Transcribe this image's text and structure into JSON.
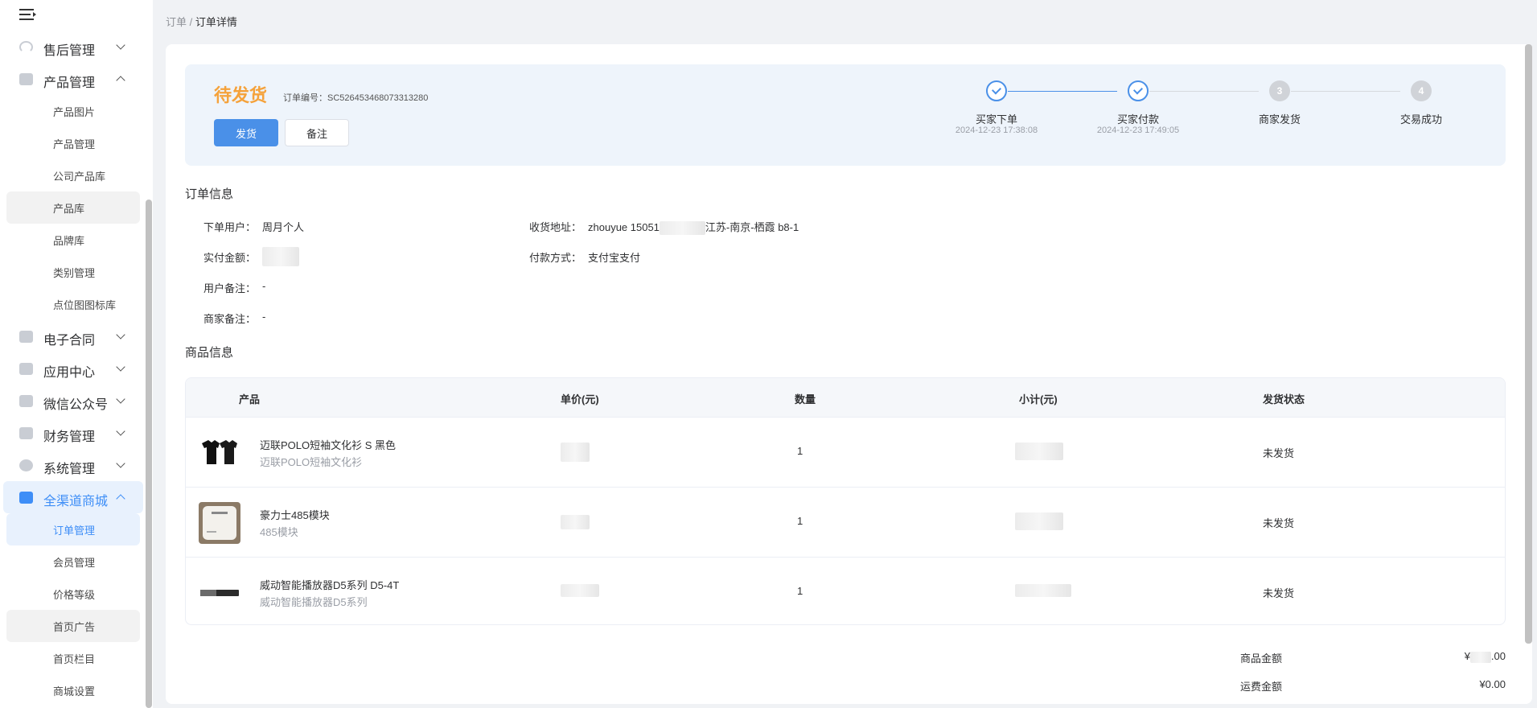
{
  "sidebar": {
    "groups": {
      "after_sales": "售后管理",
      "products": "产品管理",
      "contracts": "电子合同",
      "app_center": "应用中心",
      "wechat": "微信公众号",
      "finance": "财务管理",
      "system": "系统管理",
      "mall": "全渠道商城"
    },
    "product_items": [
      "产品图片",
      "产品管理",
      "公司产品库",
      "产品库",
      "品牌库",
      "类别管理",
      "点位图图标库"
    ],
    "mall_items": [
      "订单管理",
      "会员管理",
      "价格等级",
      "首页广告",
      "首页栏目",
      "商城设置"
    ]
  },
  "breadcrumb": {
    "root": "订单",
    "sep": "/",
    "current": "订单详情"
  },
  "order": {
    "status": "待发货",
    "order_no_label": "订单编号：",
    "order_no": "SC526453468073313280",
    "ship_button": "发货",
    "note_button": "备注"
  },
  "steps": [
    {
      "label": "买家下单",
      "time": "2024-12-23 17:38:08",
      "state": "done",
      "num": ""
    },
    {
      "label": "买家付款",
      "time": "2024-12-23 17:49:05",
      "state": "done",
      "num": ""
    },
    {
      "label": "商家发货",
      "time": "",
      "state": "todo",
      "num": "3"
    },
    {
      "label": "交易成功",
      "time": "",
      "state": "todo",
      "num": "4"
    }
  ],
  "order_info": {
    "title": "订单信息",
    "user_label": "下单用户：",
    "user": "周月个人",
    "address_label": "收货地址：",
    "address_start": "zhouyue 15051",
    "address_end": "江苏-南京-栖霞 b8-1",
    "paid_label": "实付金额：",
    "pay_method_label": "付款方式：",
    "pay_method": "支付宝支付",
    "user_note_label": "用户备注：",
    "user_note": "-",
    "merchant_note_label": "商家备注：",
    "merchant_note": "-"
  },
  "goods": {
    "title": "商品信息",
    "columns": [
      "产品",
      "单价(元)",
      "数量",
      "小计(元)",
      "发货状态"
    ],
    "rows": [
      {
        "name": "迈联POLO短袖文化衫 S 黑色",
        "sub": "迈联POLO短袖文化衫",
        "qty": "1",
        "status": "未发货",
        "thumb": "black-polo-shirts"
      },
      {
        "name": "豪力士485模块",
        "sub": "485模块",
        "qty": "1",
        "status": "未发货",
        "thumb": "white-module-box"
      },
      {
        "name": "威动智能播放器D5系列 D5-4T",
        "sub": "威动智能播放器D5系列",
        "qty": "1",
        "status": "未发货",
        "thumb": "black-player-device"
      }
    ]
  },
  "summary": {
    "goods_amount_label": "商品金额",
    "goods_amount_prefix": "¥",
    "goods_amount_suffix": ".00",
    "shipping_label": "运费金额",
    "shipping": "¥0.00"
  },
  "colors": {
    "accent": "#4a90e8",
    "status_orange": "#f5a23b",
    "panel_bg": "#eef4fb"
  }
}
